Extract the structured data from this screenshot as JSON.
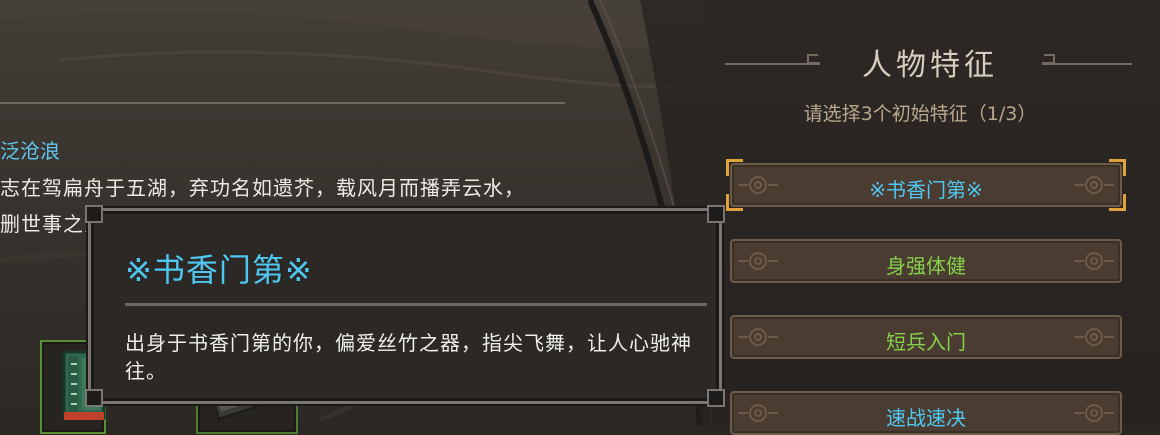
{
  "story": {
    "title": "泛沧浪",
    "line1": "志在驾扁舟于五湖，弃功名如遗芥，载风月而播弄云水，",
    "line2": "删世事之浮尘。"
  },
  "inventory": {
    "slot_icons": [
      "book-icon",
      "scroll-icon"
    ]
  },
  "panel": {
    "title": "人物特征",
    "hint": "请选择3个初始特征（1/3）",
    "traits": [
      {
        "label": "※书香门第※",
        "selected": true,
        "color": "#4fc7f2"
      },
      {
        "label": "身强体健",
        "selected": false,
        "color": "#85d14a"
      },
      {
        "label": "短兵入门",
        "selected": false,
        "color": "#85d14a"
      },
      {
        "label": "速战速决",
        "selected": false,
        "color": "#4fc7f2"
      }
    ]
  },
  "tooltip": {
    "title": "※书香门第※",
    "description": "出身于书香门第的你，偏爱丝竹之器，指尖飞舞，让人心驰神往。"
  },
  "colors": {
    "accent_blue": "#4fc7f2",
    "accent_green": "#85d14a",
    "selection_gold": "#e0a23a"
  }
}
